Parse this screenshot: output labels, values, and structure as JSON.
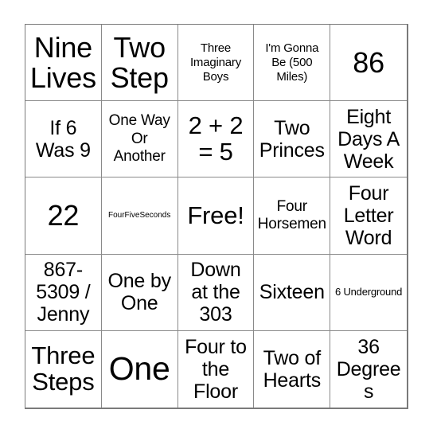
{
  "card": {
    "type": "bingo-card",
    "grid_size": "5x5",
    "free_space_index": 12,
    "colors": {
      "background": "#ffffff",
      "grid_line": "#8a8a8a",
      "outer_border": "#7a7a7a",
      "text": "#000000"
    },
    "cells": [
      {
        "text": "Nine Lives",
        "size": "fs-xl"
      },
      {
        "text": "Two Step",
        "size": "fs-xl"
      },
      {
        "text": "Three Imaginary Boys",
        "size": "fs-xs"
      },
      {
        "text": "I'm Gonna Be (500 Miles)",
        "size": "fs-xs"
      },
      {
        "text": "86",
        "size": "fs-xl"
      },
      {
        "text": "If 6 Was 9",
        "size": "fs-m"
      },
      {
        "text": "One Way Or Another",
        "size": "fs-s"
      },
      {
        "text": "2 + 2 = 5",
        "size": "fs-l"
      },
      {
        "text": "Two Princes",
        "size": "fs-m"
      },
      {
        "text": "Eight Days A Week",
        "size": "fs-m"
      },
      {
        "text": "22",
        "size": "fs-xl"
      },
      {
        "text": "FourFiveSeconds",
        "size": "fs-tiny"
      },
      {
        "text": "Free!",
        "size": "fs-l"
      },
      {
        "text": "Four Horsemen",
        "size": "fs-s"
      },
      {
        "text": "Four Letter Word",
        "size": "fs-m"
      },
      {
        "text": "867-5309 / Jenny",
        "size": "fs-m"
      },
      {
        "text": "One by One",
        "size": "fs-m"
      },
      {
        "text": "Down at the 303",
        "size": "fs-m"
      },
      {
        "text": "Sixteen",
        "size": "fs-m"
      },
      {
        "text": "6 Underground",
        "size": "fs-xxs"
      },
      {
        "text": "Three Steps",
        "size": "fs-l"
      },
      {
        "text": "One",
        "size": "fs-xxl"
      },
      {
        "text": "Four to the Floor",
        "size": "fs-m"
      },
      {
        "text": "Two of Hearts",
        "size": "fs-m"
      },
      {
        "text": "36 Degrees",
        "size": "fs-m"
      }
    ]
  }
}
